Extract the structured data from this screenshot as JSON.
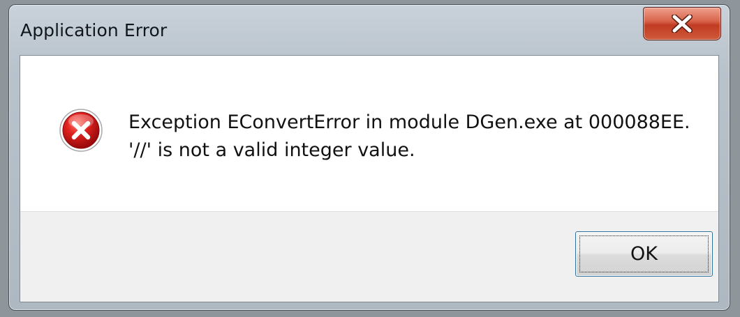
{
  "window": {
    "title": "Application Error",
    "close_label": "X"
  },
  "message": {
    "line1": "Exception EConvertError in module DGen.exe at 000088EE.",
    "line2": "'//' is not a valid integer value.",
    "icon": "error-icon"
  },
  "buttons": {
    "ok_label": "OK"
  },
  "colors": {
    "frame": "#b3bdc6",
    "close_button": "#c8452b",
    "error_icon": "#d0181c",
    "button_border": "#2f6f9c"
  }
}
